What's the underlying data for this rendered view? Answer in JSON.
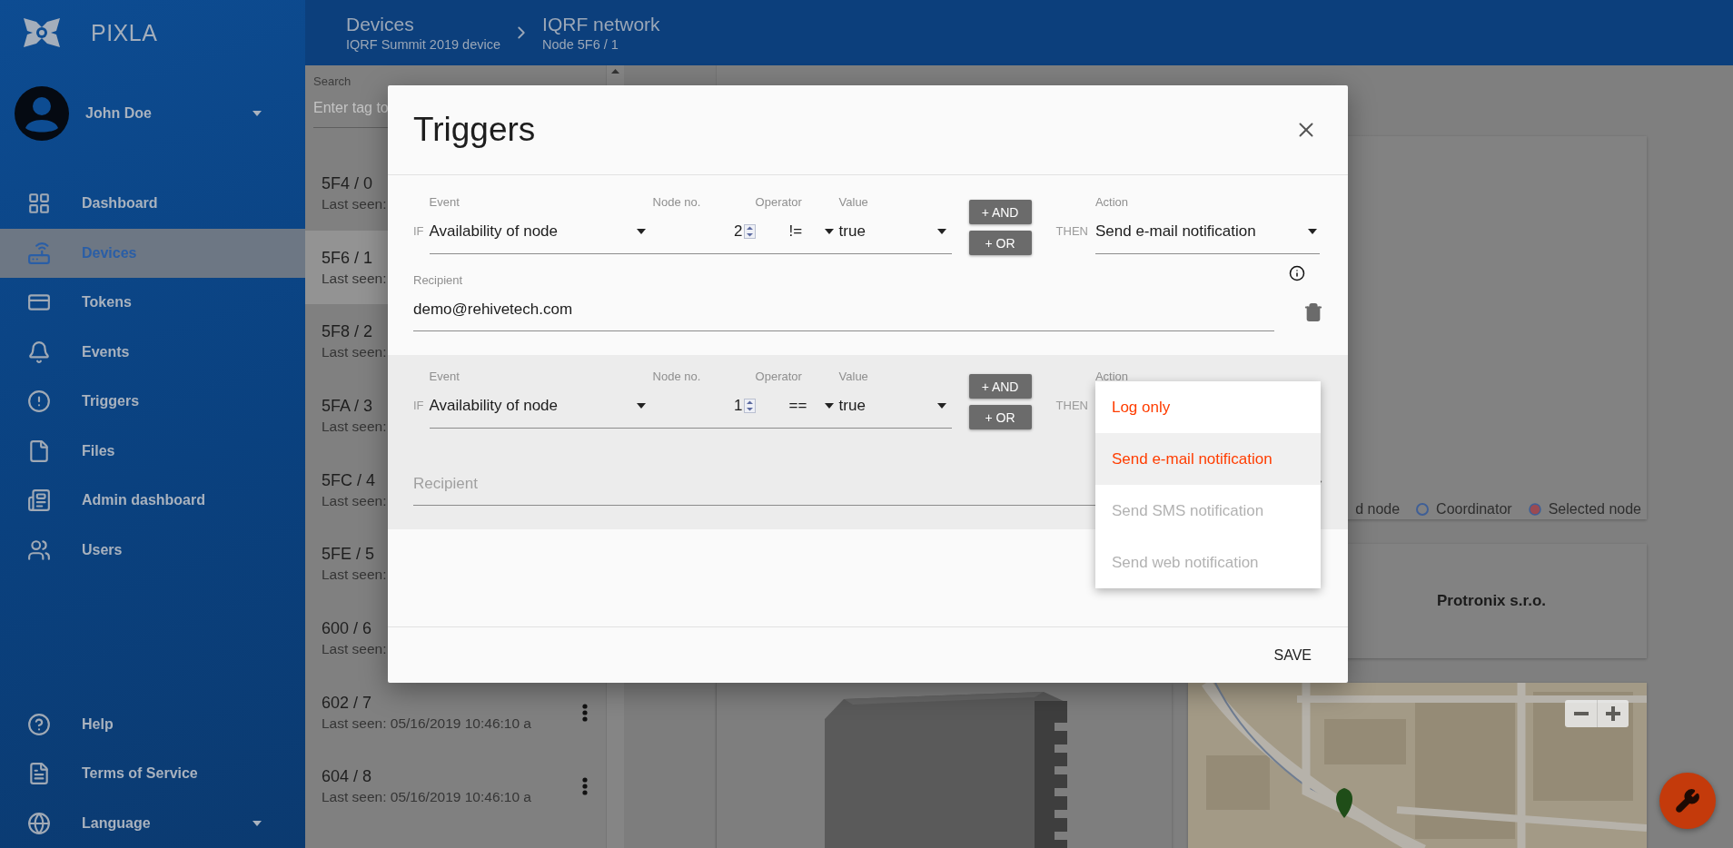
{
  "app": {
    "name": "PIXLA"
  },
  "user": {
    "name": "John Doe",
    "has_menu": true
  },
  "nav": [
    {
      "label": "Dashboard",
      "selected": false
    },
    {
      "label": "Devices",
      "selected": true
    },
    {
      "label": "Tokens",
      "selected": false
    },
    {
      "label": "Events",
      "selected": false
    },
    {
      "label": "Triggers",
      "selected": false
    },
    {
      "label": "Files",
      "selected": false
    },
    {
      "label": "Admin dashboard",
      "selected": false
    },
    {
      "label": "Users",
      "selected": false
    }
  ],
  "nav_bottom": [
    {
      "label": "Help",
      "has_menu": false
    },
    {
      "label": "Terms of Service",
      "has_menu": false
    },
    {
      "label": "Language",
      "has_menu": true
    }
  ],
  "breadcrumbs": [
    {
      "title": "Devices",
      "subtitle": "IQRF Summit 2019 device"
    },
    {
      "title": "IQRF network",
      "subtitle": "Node 5F6 / 1"
    }
  ],
  "device_list": {
    "search": {
      "label": "Search",
      "placeholder": "Enter tag to"
    },
    "items": [
      {
        "title": "5F4 / 0",
        "last_seen": "Last seen:",
        "selected": false,
        "menu": false
      },
      {
        "title": "5F6 / 1",
        "last_seen": "Last seen:",
        "selected": true,
        "menu": false
      },
      {
        "title": "5F8 / 2",
        "last_seen": "Last seen:",
        "selected": false,
        "menu": false
      },
      {
        "title": "5FA / 3",
        "last_seen": "Last seen:",
        "selected": false,
        "menu": false
      },
      {
        "title": "5FC / 4",
        "last_seen": "Last seen:",
        "selected": false,
        "menu": false
      },
      {
        "title": "5FE / 5",
        "last_seen": "Last seen:",
        "selected": false,
        "menu": false
      },
      {
        "title": "600 / 6",
        "last_seen": "Last seen:",
        "selected": false,
        "menu": false
      },
      {
        "title": "602 / 7",
        "last_seen": "Last seen: 05/16/2019 10:46:10 a",
        "selected": false,
        "menu": true
      },
      {
        "title": "604 / 8",
        "last_seen": "Last seen: 05/16/2019 10:46:10 a",
        "selected": false,
        "menu": true
      }
    ]
  },
  "network_legend": [
    {
      "label": "d node",
      "kind": "none"
    },
    {
      "label": "Coordinator",
      "kind": "outline",
      "color": "#3f5f96"
    },
    {
      "label": "Selected node",
      "kind": "filled",
      "color": "#9a4a52"
    }
  ],
  "vendor": {
    "name": "Protronix s.r.o."
  },
  "dialog": {
    "title": "Triggers",
    "rules": [
      {
        "highlighted": false,
        "if_label": "IF",
        "event": {
          "label": "Event",
          "value": "Availability of node"
        },
        "node": {
          "label": "Node no.",
          "value": "2"
        },
        "operator": {
          "label": "Operator",
          "value": "!="
        },
        "value": {
          "label": "Value",
          "value": "true"
        },
        "and_button": "+ AND",
        "or_button": "+ OR",
        "then_label": "THEN",
        "action": {
          "label": "Action",
          "value": "Send e-mail notification"
        },
        "recipient": {
          "label": "Recipient",
          "value": "demo@rehivetech.com"
        },
        "info": true
      },
      {
        "highlighted": true,
        "if_label": "IF",
        "event": {
          "label": "Event",
          "value": "Availability of node"
        },
        "node": {
          "label": "Node no.",
          "value": "1"
        },
        "operator": {
          "label": "Operator",
          "value": "=="
        },
        "value": {
          "label": "Value",
          "value": "true"
        },
        "and_button": "+ AND",
        "or_button": "+ OR",
        "then_label": "THEN",
        "action": {
          "label": "Action",
          "menu": [
            {
              "label": "Log only",
              "selected": false,
              "disabled": false
            },
            {
              "label": "Send e-mail notification",
              "selected": true,
              "disabled": false
            },
            {
              "label": "Send SMS notification",
              "selected": false,
              "disabled": true
            },
            {
              "label": "Send web notification",
              "selected": false,
              "disabled": true
            }
          ]
        },
        "recipient": {
          "placeholder": "Recipient"
        },
        "info": false
      }
    ],
    "save_button": "SAVE"
  }
}
